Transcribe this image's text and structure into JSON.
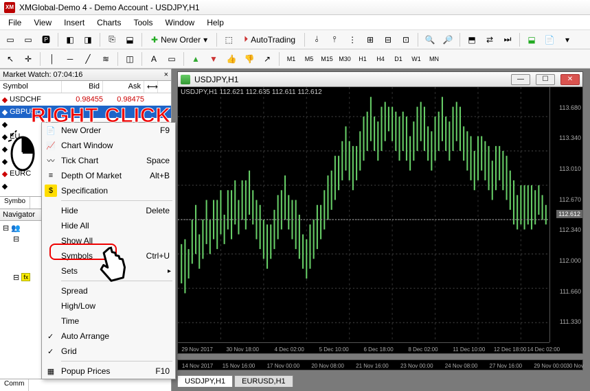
{
  "title": "XMGlobal-Demo 4 - Demo Account - USDJPY,H1",
  "menus": [
    "File",
    "View",
    "Insert",
    "Charts",
    "Tools",
    "Window",
    "Help"
  ],
  "toolbar1": {
    "new_order": "New Order",
    "autotrading": "AutoTrading"
  },
  "timeframes": [
    "M1",
    "M5",
    "M15",
    "M30",
    "H1",
    "H4",
    "D1",
    "W1",
    "MN"
  ],
  "market_watch": {
    "title": "Market Watch: 07:04:16",
    "cols": {
      "symbol": "Symbol",
      "bid": "Bid",
      "ask": "Ask"
    },
    "rows": [
      {
        "dir": "dn",
        "sym": "USDCHF",
        "bid": "0.98455",
        "ask": "0.98475"
      },
      {
        "dir": "up",
        "sym": "GBPUSD",
        "bid": "",
        "ask": "",
        "sel": true
      },
      {
        "dir": "",
        "sym": "",
        "bid": "",
        "ask": ""
      },
      {
        "dir": "",
        "sym": "EU",
        "bid": "",
        "ask": ""
      },
      {
        "dir": "",
        "sym": "",
        "bid": "",
        "ask": ""
      },
      {
        "dir": "",
        "sym": "",
        "bid": "",
        "ask": ""
      },
      {
        "dir": "dn",
        "sym": "EURC",
        "bid": "",
        "ask": ""
      },
      {
        "dir": "",
        "sym": "",
        "bid": "",
        "ask": ""
      }
    ],
    "tab": "Symbo"
  },
  "navigator": {
    "title": "Navigator",
    "tab": "Comm"
  },
  "context_menu": {
    "items": [
      {
        "label": "New Order",
        "key": "F9",
        "icon": "📄"
      },
      {
        "label": "Chart Window",
        "icon": "📈"
      },
      {
        "label": "Tick Chart",
        "key": "Space",
        "icon": "〰"
      },
      {
        "label": "Depth Of Market",
        "key": "Alt+B",
        "icon": "≡"
      },
      {
        "label": "Specification",
        "icon": "$"
      },
      {
        "sep": true
      },
      {
        "label": "Hide",
        "key": "Delete"
      },
      {
        "label": "Hide All"
      },
      {
        "label": "Show All",
        "highlight": true
      },
      {
        "label": "Symbols",
        "key": "Ctrl+U"
      },
      {
        "label": "Sets",
        "sub": true
      },
      {
        "sep": true
      },
      {
        "label": "Spread"
      },
      {
        "label": "High/Low"
      },
      {
        "label": "Time"
      },
      {
        "label": "Auto Arrange",
        "check": true
      },
      {
        "label": "Grid",
        "check": true
      },
      {
        "sep": true
      },
      {
        "label": "Popup Prices",
        "key": "F10",
        "icon": "▦"
      }
    ]
  },
  "annotation": "RIGHT CLICK",
  "chart": {
    "window_title": "USDJPY,H1",
    "top_label": "USDJPY,H1  112.621 112.635 112.611 112.612",
    "y_ticks": [
      "113.680",
      "113.340",
      "113.010",
      "112.670",
      "112.612",
      "112.340",
      "112.000",
      "111.660",
      "111.330"
    ],
    "x_ticks": [
      "29 Nov 2017",
      "30 Nov 18:00",
      "4 Dec 02:00",
      "5 Dec 10:00",
      "6 Dec 18:00",
      "8 Dec 02:00",
      "11 Dec 10:00",
      "12 Dec 18:00",
      "14 Dec 02:00"
    ],
    "lower_x_ticks": [
      "14 Nov 2017",
      "15 Nov 16:00",
      "17 Nov 00:00",
      "20 Nov 08:00",
      "21 Nov 16:00",
      "23 Nov 00:00",
      "24 Nov 08:00",
      "27 Nov 16:00",
      "29 Nov 00:00",
      "30 Nov"
    ],
    "tabs": [
      "USDJPY,H1",
      "EURUSD,H1"
    ]
  },
  "chart_data": {
    "type": "bar",
    "title": "USDJPY,H1",
    "ylim": [
      111.33,
      113.68
    ],
    "current_price": 112.612,
    "x": [
      "29 Nov 2017",
      "30 Nov 18:00",
      "4 Dec 02:00",
      "5 Dec 10:00",
      "6 Dec 18:00",
      "8 Dec 02:00",
      "11 Dec 10:00",
      "12 Dec 18:00",
      "14 Dec 02:00"
    ],
    "ohlc_sample": {
      "open": 112.621,
      "high": 112.635,
      "low": 112.611,
      "close": 112.612
    }
  }
}
